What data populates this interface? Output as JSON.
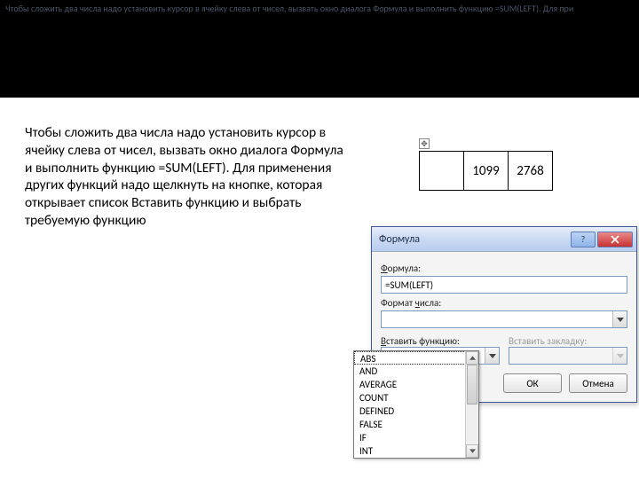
{
  "banner_text": "Чтобы сложить два числа надо установить курсор в ячейку слева от чисел, вызвать окно диалога Формула и выполнить функцию =SUM(LEFT). Для при",
  "body_text": " Чтобы сложить два числа надо установить курсор в ячейку слева от чисел, вызвать окно диалога Формула и выполнить функцию =SUM(LEFT). Для применения других функций надо щелкнуть на кнопке, которая открывает список Вставить функцию и выбрать требуемую функцию",
  "table": {
    "move_handle": "✥",
    "cells": [
      "",
      "1099",
      "2768"
    ]
  },
  "dialog": {
    "title": "Формула",
    "help_symbol": "?",
    "formula_label_prefix": "Ф",
    "formula_label_rest": "ормула:",
    "formula_value": "=SUM(LEFT)",
    "numfmt_label_prefix_plain": "Формат ",
    "numfmt_label_underline": "ч",
    "numfmt_label_suffix": "исла:",
    "numfmt_value": "",
    "insert_label_prefix": "В",
    "insert_label_rest": "ставить функцию:",
    "bookmark_label": "Вставить закладку:",
    "ok": "ОК",
    "cancel": "Отмена"
  },
  "dropdown": {
    "options": [
      "ABS",
      "AND",
      "AVERAGE",
      "COUNT",
      "DEFINED",
      "FALSE",
      "IF",
      "INT"
    ]
  }
}
